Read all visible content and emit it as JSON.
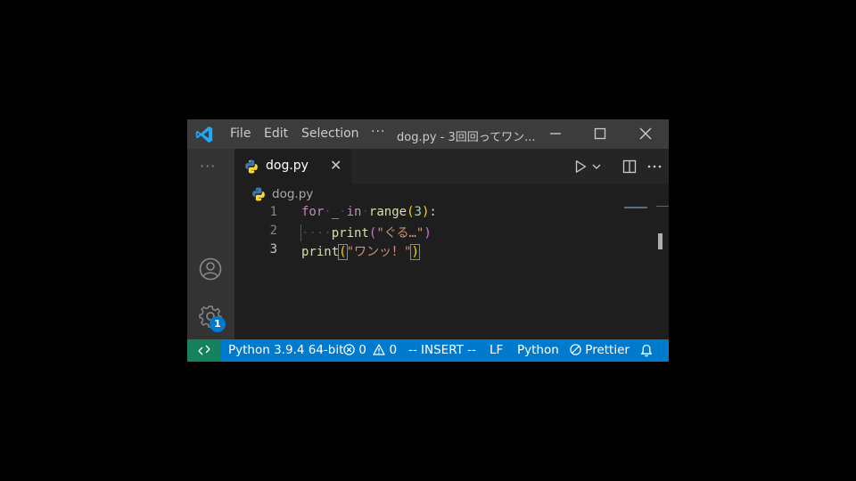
{
  "menu": {
    "file": "File",
    "edit": "Edit",
    "selection": "Selection",
    "more": "···"
  },
  "window_title": "dog.py - 3回回ってワン...",
  "activity": {
    "more": "···",
    "settings_badge": "1"
  },
  "tab": {
    "label": "dog.py"
  },
  "breadcrumb": {
    "file": "dog.py"
  },
  "editor": {
    "line_numbers": [
      "1",
      "2",
      "3"
    ],
    "lines": {
      "l1": {
        "for": "for",
        "var": "_",
        "in": "in",
        "range": "range",
        "open": "(",
        "num": "3",
        "close": ")",
        "colon": ":"
      },
      "l2": {
        "print": "print",
        "open": "(",
        "str": "\"ぐる…\"",
        "close": ")"
      },
      "l3": {
        "print": "print",
        "open": "(",
        "str": "\"ワンッ！\"",
        "close": ")"
      }
    }
  },
  "status": {
    "interpreter": "Python 3.9.4 64-bit",
    "errors": "0",
    "warnings": "0",
    "mode": "-- INSERT --",
    "eol": "LF",
    "language": "Python",
    "formatter": "Prettier"
  },
  "colors": {
    "accent": "#007acc",
    "remote": "#16825d",
    "keyword": "#c586c0",
    "function": "#dcdcaa",
    "string": "#ce9178"
  },
  "icons": [
    "vscode-logo-icon",
    "minimize-icon",
    "maximize-icon",
    "close-icon",
    "account-icon",
    "gear-icon",
    "python-file-icon",
    "run-icon",
    "chevron-down-icon",
    "split-editor-icon",
    "remote-icon",
    "error-icon",
    "warning-icon",
    "prettier-icon",
    "bell-icon"
  ]
}
